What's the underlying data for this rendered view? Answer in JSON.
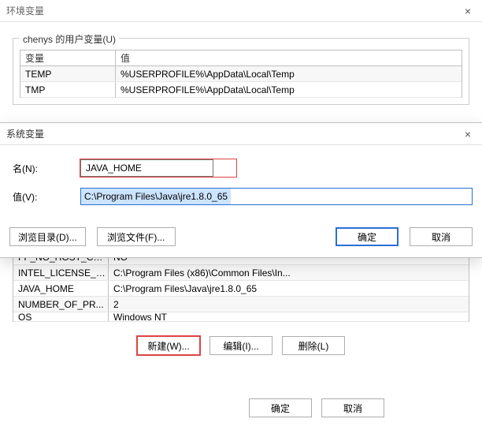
{
  "window": {
    "title": "环境变量",
    "close_glyph": "×"
  },
  "user_vars": {
    "legend": "chenys 的用户变量(U)",
    "headers": {
      "name": "变量",
      "value": "值"
    },
    "rows": [
      {
        "name": "TEMP",
        "value": "%USERPROFILE%\\AppData\\Local\\Temp"
      },
      {
        "name": "TMP",
        "value": "%USERPROFILE%\\AppData\\Local\\Temp"
      }
    ]
  },
  "dialog": {
    "title": "系统变量",
    "close_glyph": "×",
    "name_label": "名(N):",
    "value_label": "值(V):",
    "name_value": "JAVA_HOME",
    "value_value": "C:\\Program Files\\Java\\jre1.8.0_65",
    "browse_dir": "浏览目录(D)...",
    "browse_file": "浏览文件(F)...",
    "ok": "确定",
    "cancel": "取消"
  },
  "sys_vars": {
    "rows": [
      {
        "name": "FP_NO_HOST_CH...",
        "value": "NO"
      },
      {
        "name": "INTEL_LICENSE_F...",
        "value": "C:\\Program Files (x86)\\Common Files\\In..."
      },
      {
        "name": "JAVA_HOME",
        "value": "C:\\Program Files\\Java\\jre1.8.0_65"
      },
      {
        "name": "NUMBER_OF_PR...",
        "value": "2"
      },
      {
        "name": "OS",
        "value": "Windows NT"
      }
    ],
    "new": "新建(W)...",
    "edit": "编辑(I)...",
    "delete": "删除(L)"
  },
  "footer": {
    "ok": "确定",
    "cancel": "取消"
  }
}
